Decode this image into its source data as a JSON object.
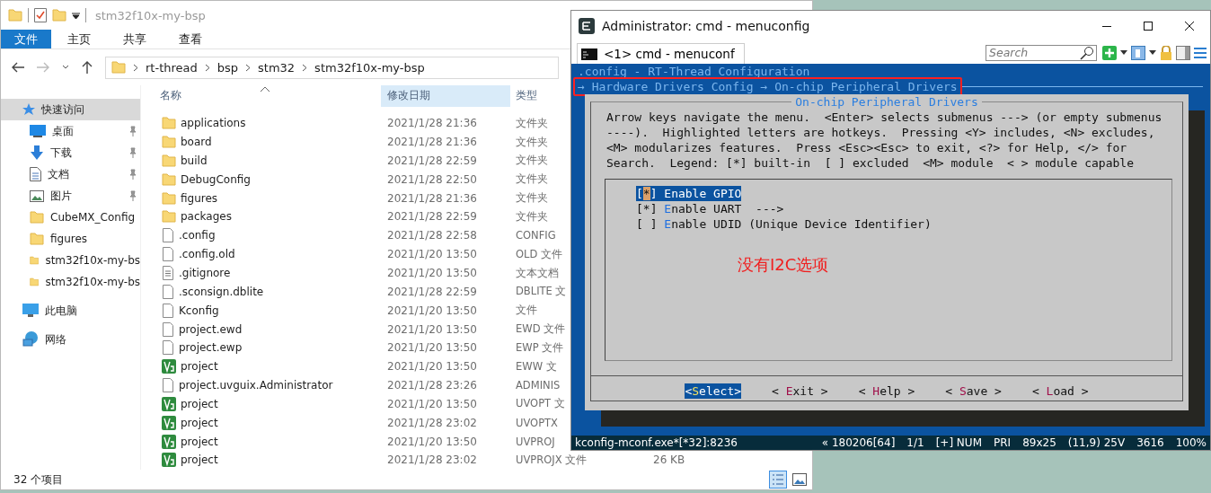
{
  "explorer": {
    "title": "stm32f10x-my-bsp",
    "ribbon_tabs": [
      {
        "label": "文件",
        "selected": true
      },
      {
        "label": "主页",
        "selected": false
      },
      {
        "label": "共享",
        "selected": false
      },
      {
        "label": "查看",
        "selected": false
      }
    ],
    "breadcrumb": [
      "rt-thread",
      "bsp",
      "stm32",
      "stm32f10x-my-bsp"
    ],
    "sidebar": {
      "items": [
        {
          "label": "快速访问",
          "selected": true,
          "children": [
            {
              "label": "桌面",
              "selected": false,
              "pinned": true
            },
            {
              "label": "下载",
              "selected": false,
              "pinned": true
            },
            {
              "label": "文档",
              "selected": false,
              "pinned": true
            },
            {
              "label": "图片",
              "selected": false,
              "pinned": true
            },
            {
              "label": "CubeMX_Config",
              "selected": false,
              "pinned": false
            },
            {
              "label": "figures",
              "selected": false,
              "pinned": false
            },
            {
              "label": "stm32f10x-my-bs",
              "selected": false,
              "pinned": false
            },
            {
              "label": "stm32f10x-my-bs",
              "selected": false,
              "pinned": false
            }
          ]
        },
        {
          "label": "此电脑",
          "selected": false
        },
        {
          "label": "网络",
          "selected": false
        }
      ]
    },
    "columns": [
      {
        "label": "名称",
        "sorted": true,
        "highlighted": false
      },
      {
        "label": "修改日期",
        "sorted": false,
        "highlighted": true
      },
      {
        "label": "类型",
        "sorted": false,
        "highlighted": false
      }
    ],
    "files": [
      {
        "name": "applications",
        "date": "2021/1/28 21:36",
        "type": "文件夹",
        "kind": "folder"
      },
      {
        "name": "board",
        "date": "2021/1/28 21:36",
        "type": "文件夹",
        "kind": "folder"
      },
      {
        "name": "build",
        "date": "2021/1/28 22:59",
        "type": "文件夹",
        "kind": "folder"
      },
      {
        "name": "DebugConfig",
        "date": "2021/1/28 22:50",
        "type": "文件夹",
        "kind": "folder"
      },
      {
        "name": "figures",
        "date": "2021/1/28 21:36",
        "type": "文件夹",
        "kind": "folder"
      },
      {
        "name": "packages",
        "date": "2021/1/28 22:59",
        "type": "文件夹",
        "kind": "folder"
      },
      {
        "name": ".config",
        "date": "2021/1/28 22:58",
        "type": "CONFIG",
        "kind": "file"
      },
      {
        "name": ".config.old",
        "date": "2021/1/20 13:50",
        "type": "OLD 文件",
        "kind": "file"
      },
      {
        "name": ".gitignore",
        "date": "2021/1/20 13:50",
        "type": "文本文档",
        "kind": "text"
      },
      {
        "name": ".sconsign.dblite",
        "date": "2021/1/28 22:59",
        "type": "DBLITE 文",
        "kind": "file"
      },
      {
        "name": "Kconfig",
        "date": "2021/1/20 13:50",
        "type": "文件",
        "kind": "file"
      },
      {
        "name": "project.ewd",
        "date": "2021/1/20 13:50",
        "type": "EWD 文件",
        "kind": "file"
      },
      {
        "name": "project.ewp",
        "date": "2021/1/20 13:50",
        "type": "EWP 文件",
        "kind": "file"
      },
      {
        "name": "project",
        "date": "2021/1/20 13:50",
        "type": "EWW 文",
        "kind": "keil"
      },
      {
        "name": "project.uvguix.Administrator",
        "date": "2021/1/28 23:26",
        "type": "ADMINIS",
        "kind": "file"
      },
      {
        "name": "project",
        "date": "2021/1/20 13:50",
        "type": "UVOPT 文",
        "kind": "keil"
      },
      {
        "name": "project",
        "date": "2021/1/28 23:02",
        "type": "UVOPTX",
        "kind": "keil"
      },
      {
        "name": "project",
        "date": "2021/1/20 13:50",
        "type": "UVPROJ",
        "kind": "keil"
      },
      {
        "name": "project",
        "date": "2021/1/28 23:02",
        "type": "UVPROJX 文件",
        "size": "26 KB",
        "kind": "keil"
      }
    ],
    "status": "32 个项目"
  },
  "cmd": {
    "title": "Administrator: cmd - menuconfig",
    "tab": "<1> cmd - menuconf",
    "search": {
      "placeholder": "Search"
    },
    "console": {
      "header": ".config - RT-Thread Configuration",
      "breadcrumb": {
        "text": "→ Hardware Drivers Config → On-chip Peripheral Drivers",
        "highlighted": true
      },
      "dialog_title": "On-chip Peripheral Drivers",
      "help": "Arrow keys navigate the menu.  <Enter> selects submenus ---> (or empty submenus\n----).  Highlighted letters are hotkeys.  Pressing <Y> includes, <N> excludes,\n<M> modularizes features.  Press <Esc><Esc> to exit, <?> for Help, </> for\nSearch.  Legend: [*] built-in  [ ] excluded  <M> module  < > module capable",
      "menu": {
        "items": [
          {
            "box": "[*]",
            "label": "Enable GPIO",
            "selected": true
          },
          {
            "box": "[*]",
            "label": "Enable UART  --->",
            "selected": false
          },
          {
            "box": "[ ]",
            "label": "Enable UDID (Unique Device Identifier)",
            "selected": false
          }
        ]
      },
      "annotation": "没有I2C选项",
      "buttons": [
        {
          "label": "<Select>",
          "selected": true
        },
        {
          "label": "< Exit >",
          "selected": false
        },
        {
          "label": "< Help >",
          "selected": false
        },
        {
          "label": "< Save >",
          "selected": false
        },
        {
          "label": "< Load >",
          "selected": false
        }
      ]
    },
    "status": {
      "process": "kconfig-mconf.exe*[*32]:8236",
      "items": [
        "« 180206[64]",
        "1/1",
        "[+] NUM",
        "PRI",
        "89x25",
        "(11,9) 25V",
        "3616",
        "100%"
      ]
    }
  }
}
